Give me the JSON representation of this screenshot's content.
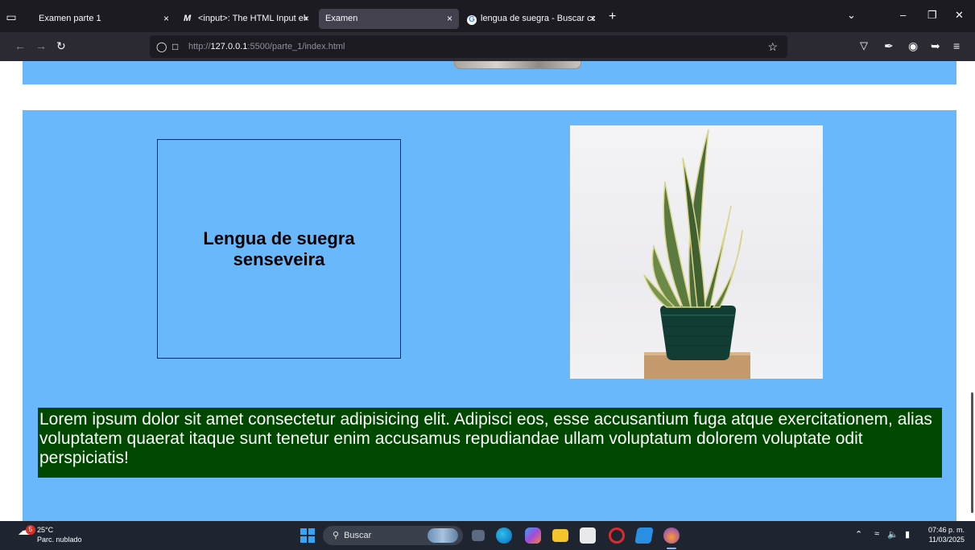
{
  "browser": {
    "tabs": [
      {
        "label": "Examen parte 1",
        "close": "×"
      },
      {
        "label": "<input>: The HTML Input eleme",
        "favicon": "M",
        "close": "×"
      },
      {
        "label": "Examen",
        "close": "×"
      },
      {
        "label": "lengua de suegra - Buscar con G",
        "favicon": "G",
        "close": "×"
      }
    ],
    "new_tab": "+",
    "url_host_prefix": "http://",
    "url_host": "127.0.0.1",
    "url_rest": ":5500/parte_1/index.html"
  },
  "page": {
    "card_title": "Lengua de suegra senseveira",
    "lorem": "Lorem ipsum dolor sit amet consectetur adipisicing elit. Adipisci eos, esse accusantium fuga atque exercitationem, alias voluptatem quaerat itaque sunt tenetur enim accusamus repudiandae ullam voluptatum dolorem voluptate odit perspiciatis!",
    "colors": {
      "section_bg": "#69b8fc",
      "text_box_bg": "#004800"
    }
  },
  "taskbar": {
    "weather_badge": "5",
    "temperature": "25°C",
    "condition": "Parc. nublado",
    "search_placeholder": "Buscar",
    "time": "07:46 p. m.",
    "date": "11/03/2025"
  }
}
